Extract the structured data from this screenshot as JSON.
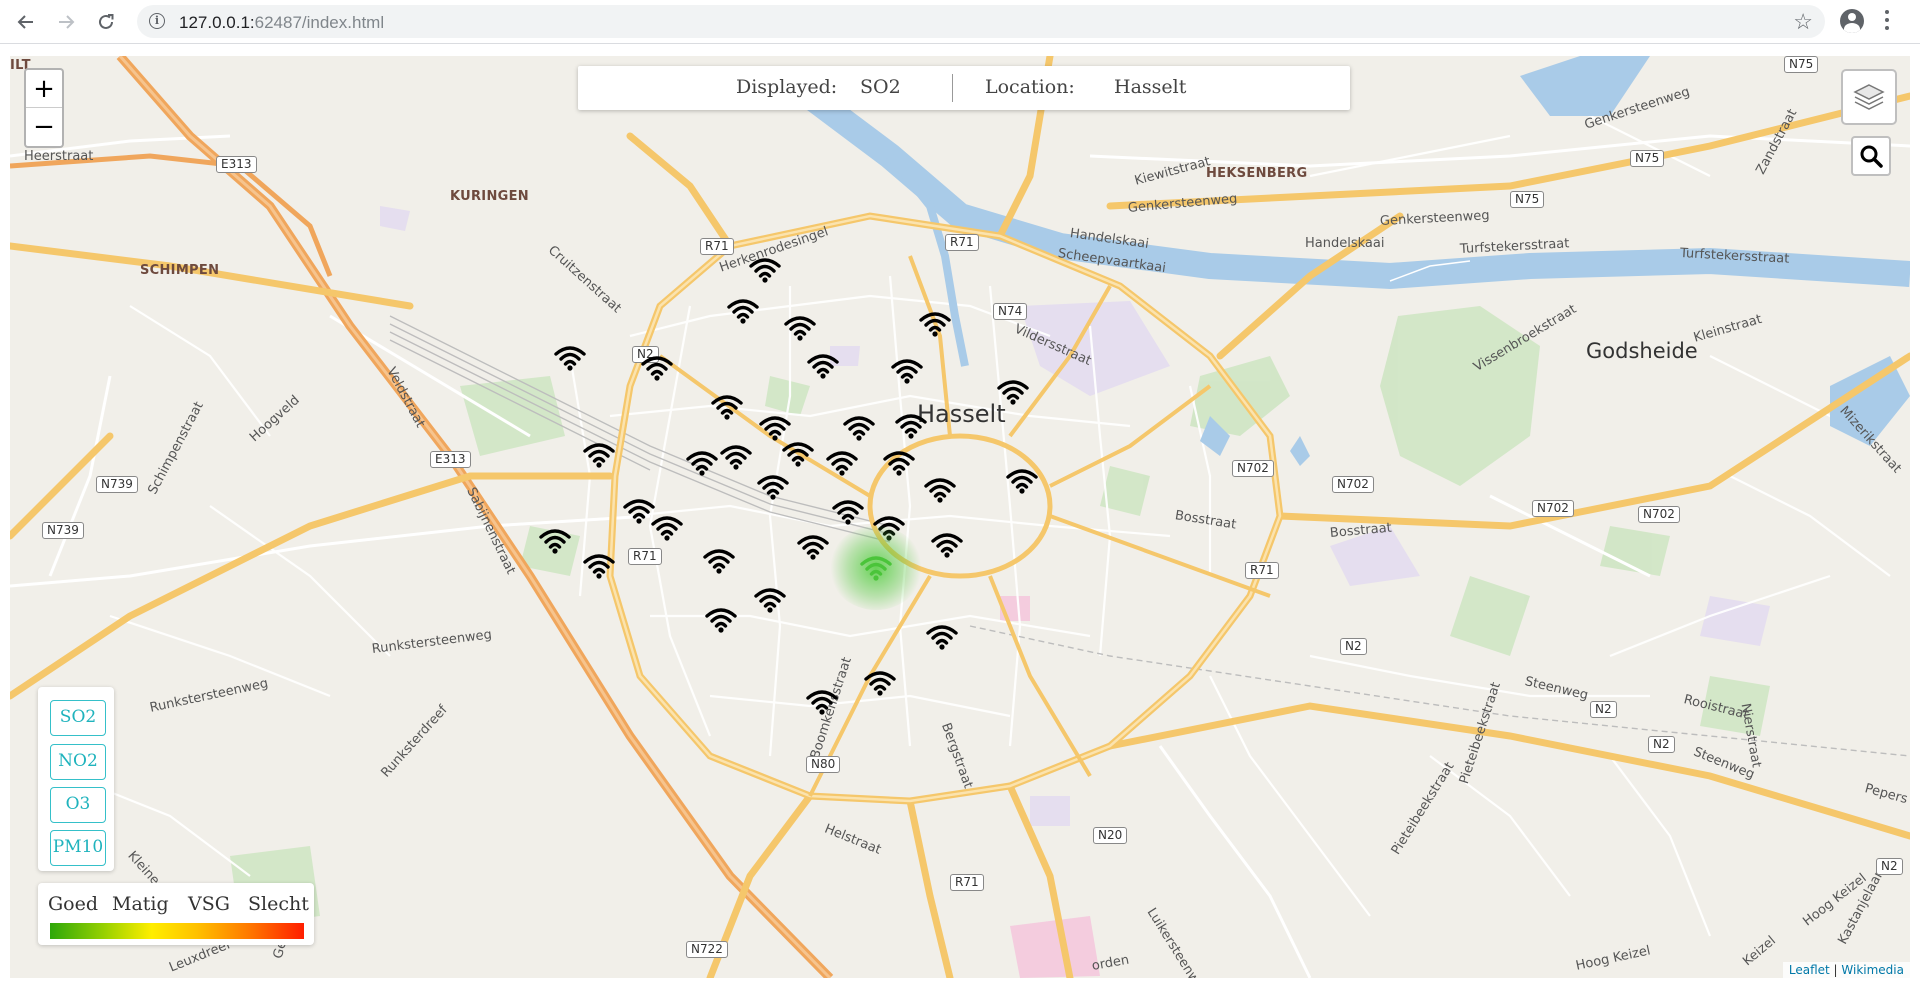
{
  "browser": {
    "url_host": "127.0.0.1:",
    "url_rest": "62487/index.html"
  },
  "infobar": {
    "displayed_label": "Displayed:",
    "displayed_value": "SO2",
    "location_label": "Location:",
    "location_value": "Hasselt"
  },
  "zoom": {
    "in": "+",
    "out": "−"
  },
  "pollutant_buttons": [
    "SO2",
    "NO2",
    "O3",
    "PM10"
  ],
  "legend": {
    "labels": [
      "Goed",
      "Matig",
      "VSG",
      "Slecht"
    ]
  },
  "attribution": {
    "leaflet": "Leaflet",
    "sep": " | ",
    "tiles": "Wikimedia"
  },
  "map_labels": {
    "places": [
      "KURINGEN",
      "SCHIMPEN",
      "HEKSENBERG",
      "ILT"
    ],
    "city": "Hasselt",
    "town": "Godsheide",
    "streets": [
      "Heerstraat",
      "Herkenrodesingel",
      "Cruitzenstraat",
      "Veldstraat",
      "Hoogveld",
      "Schimpenstraat",
      "Runkstersteenweg",
      "Runksterdreef",
      "Sabijnenstraat",
      "Kiewitstraat",
      "Genkersteenweg",
      "Handelskaai",
      "Scheepvaartkaai",
      "Turfstekersstraat",
      "Vildersstraat",
      "Vissenbroekstraat",
      "Kleinstraat",
      "Bosstraat",
      "Steenweg",
      "Rooistraat",
      "Boomkensstraat",
      "Bergstraat",
      "Helstraat",
      "Luikersteenweg",
      "Pieteibeekstraat",
      "Hoog Keizel",
      "Zandstraat",
      "Genkersteenweg",
      "Mizerikstraat",
      "Nierstraat",
      "Kastanjelaar",
      "Kleine Roos",
      "Gerkstraat",
      "Keizel",
      "Pepers",
      "Leuxdreef",
      "orden"
    ],
    "shields": [
      "E313",
      "E313",
      "R71",
      "R71",
      "R71",
      "R71",
      "R71",
      "N2",
      "N2",
      "N2",
      "N2",
      "N2",
      "N74",
      "N75",
      "N75",
      "N75",
      "N702",
      "N702",
      "N702",
      "N702",
      "N739",
      "N739",
      "N80",
      "N20",
      "N722"
    ]
  },
  "sensors": {
    "count": 36,
    "active_color": "#4bc43a"
  },
  "colors": {
    "accent": "#1fb3bd",
    "river": "#a9cbe8",
    "primary_road": "#f5c76b",
    "motorway": "#f0a65c"
  }
}
